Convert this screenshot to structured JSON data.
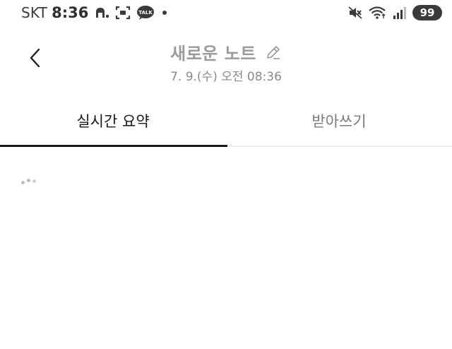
{
  "status_bar": {
    "carrier": "SKT",
    "time": "8:36",
    "battery": "99",
    "icons": [
      "assistant-icon",
      "screenshot-icon",
      "kakaotalk-icon",
      "notification-dot-icon",
      "mute-icon",
      "wifi-icon",
      "signal-icon"
    ],
    "talk_label": "TALK"
  },
  "header": {
    "title": "새로운 노트",
    "date": "7. 9.(수) 오전 08:36",
    "icons": [
      "back-icon",
      "edit-pencil-icon"
    ]
  },
  "tabs": [
    {
      "label": "실시간 요약",
      "active": true
    },
    {
      "label": "받아쓰기",
      "active": false
    }
  ],
  "colors": {
    "text_primary": "#1a1a1a",
    "text_muted": "#9a9a9a",
    "underline": "#1a1a1a"
  }
}
